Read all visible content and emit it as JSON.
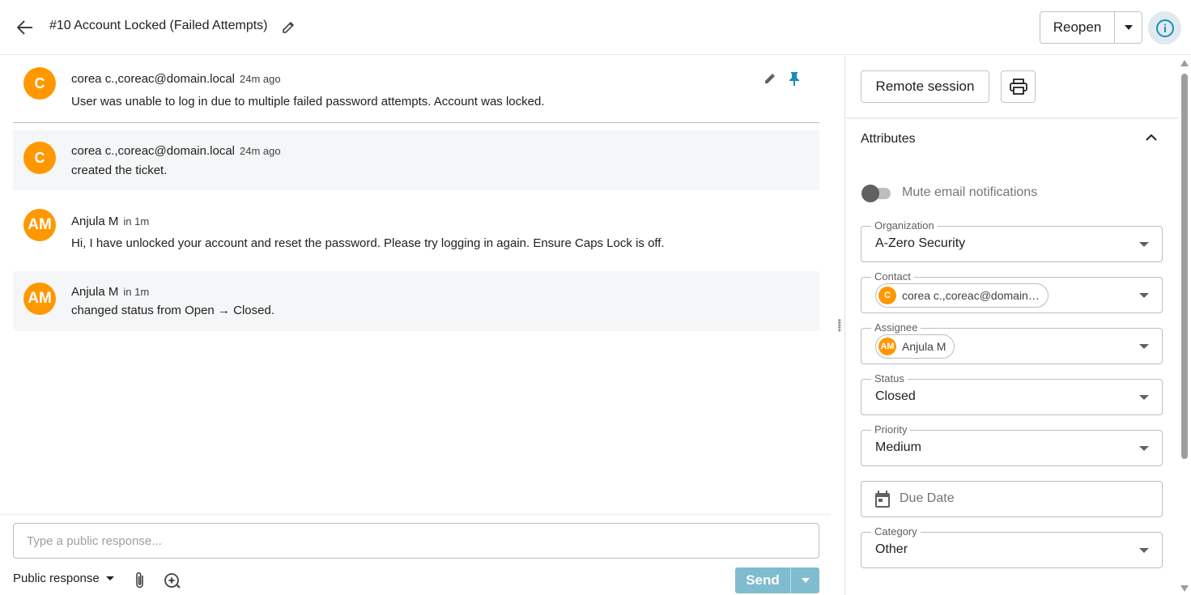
{
  "header": {
    "title": "#10 Account Locked (Failed Attempts)",
    "reopen_label": "Reopen"
  },
  "messages": [
    {
      "avatar": "C",
      "author": "corea c.,coreac@domain.local",
      "time": "24m ago",
      "body": "User was unable to log in due to multiple failed password attempts. Account was locked."
    },
    {
      "avatar": "C",
      "author": "corea c.,coreac@domain.local",
      "time": "24m ago",
      "body": "created the ticket."
    },
    {
      "avatar": "AM",
      "author": "Anjula M",
      "time": "in 1m",
      "body": "Hi, I have unlocked your account and reset the password. Please try logging in again. Ensure Caps Lock is off."
    },
    {
      "avatar": "AM",
      "author": "Anjula M",
      "time": "in 1m",
      "body_prefix": "changed status from ",
      "status_from": "Open",
      "arrow": " → ",
      "status_to": "Closed",
      "body_suffix": "."
    }
  ],
  "composer": {
    "placeholder": "Type a public response...",
    "response_type": "Public response",
    "send_label": "Send"
  },
  "sidebar": {
    "remote_session_label": "Remote session",
    "attributes_title": "Attributes",
    "mute_label": "Mute email notifications",
    "mute_enabled": false,
    "fields": {
      "organization": {
        "label": "Organization",
        "value": "A-Zero Security"
      },
      "contact": {
        "label": "Contact",
        "avatar": "C",
        "value": "corea c.,coreac@domain…"
      },
      "assignee": {
        "label": "Assignee",
        "avatar": "AM",
        "value": "Anjula M"
      },
      "status": {
        "label": "Status",
        "value": "Closed"
      },
      "priority": {
        "label": "Priority",
        "value": "Medium"
      },
      "due_date": {
        "placeholder": "Due Date"
      },
      "category": {
        "label": "Category",
        "value": "Other"
      }
    }
  },
  "colors": {
    "avatar": "#ff9800",
    "accent": "#1a8fb5",
    "send_disabled": "#7fbccf"
  }
}
